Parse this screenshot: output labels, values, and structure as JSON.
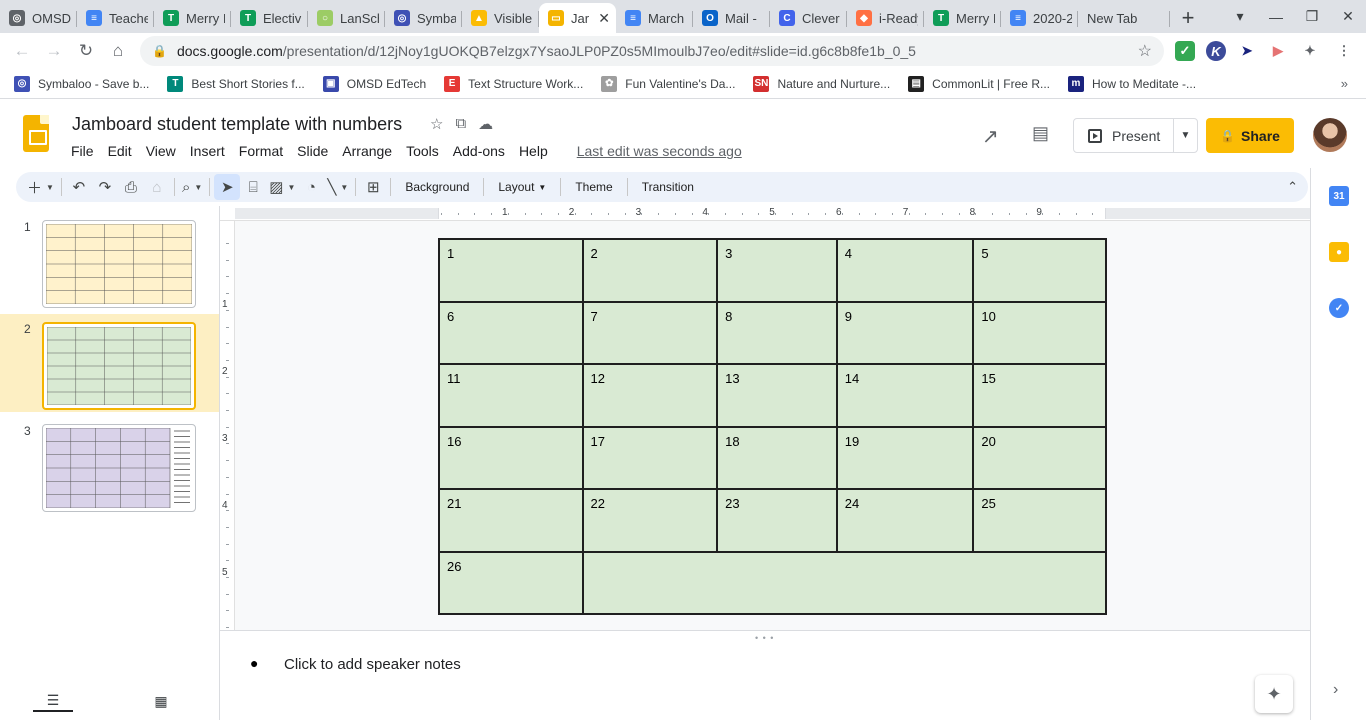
{
  "browser": {
    "tabs": [
      {
        "label": "OMSD",
        "icon": "omsd-icon",
        "color": "#5f6368",
        "glyph": "◎"
      },
      {
        "label": "Teache",
        "icon": "docs-icon",
        "color": "#4285f4",
        "glyph": "≡"
      },
      {
        "label": "Merry I",
        "icon": "sheets-plus-icon",
        "color": "#0f9d58",
        "glyph": "T"
      },
      {
        "label": "Electiv",
        "icon": "sheets-plus-icon",
        "color": "#0f9d58",
        "glyph": "T"
      },
      {
        "label": "LanSch",
        "icon": "lanschool-icon",
        "color": "#9ccc65",
        "glyph": "○"
      },
      {
        "label": "Symba",
        "icon": "symbaloo-icon",
        "color": "#3f51b5",
        "glyph": "◎"
      },
      {
        "label": "Visible",
        "icon": "drive-icon",
        "color": "#fbbc04",
        "glyph": "▲"
      },
      {
        "label": "Jar",
        "icon": "slides-icon",
        "color": "#f4b400",
        "glyph": "▭",
        "active": true
      },
      {
        "label": "March",
        "icon": "docs-icon",
        "color": "#4285f4",
        "glyph": "≡"
      },
      {
        "label": "Mail -",
        "icon": "outlook-icon",
        "color": "#0a64c9",
        "glyph": "O"
      },
      {
        "label": "Clever",
        "icon": "clever-icon",
        "color": "#4263eb",
        "glyph": "C"
      },
      {
        "label": "i-Ready",
        "icon": "iready-icon",
        "color": "#ff7043",
        "glyph": "◆"
      },
      {
        "label": "Merry I",
        "icon": "sheets-plus-icon",
        "color": "#0f9d58",
        "glyph": "T"
      },
      {
        "label": "2020-2",
        "icon": "docs-icon",
        "color": "#4285f4",
        "glyph": "≡"
      },
      {
        "label": "New Tab",
        "icon": "",
        "color": "",
        "glyph": ""
      }
    ],
    "url_host": "docs.google.com",
    "url_path": "/presentation/d/12jNoy1gUOKQB7elzgx7YsaoJLP0PZ0s5MImoulbJ7eo/edit#slide=id.g6c8b8fe1b_0_5",
    "bookmarks": [
      {
        "label": "Symbaloo - Save b...",
        "icon": "symbaloo-icon",
        "color": "#3f51b5",
        "glyph": "◎"
      },
      {
        "label": "Best Short Stories f...",
        "icon": "t-icon",
        "color": "#00897b",
        "glyph": "T"
      },
      {
        "label": "OMSD EdTech",
        "icon": "omsd-edtech-icon",
        "color": "#3949ab",
        "glyph": "▣"
      },
      {
        "label": "Text Structure Work...",
        "icon": "e-icon",
        "color": "#e53935",
        "glyph": "E"
      },
      {
        "label": "Fun Valentine's Da...",
        "icon": "valentine-icon",
        "color": "#9e9e9e",
        "glyph": "✿"
      },
      {
        "label": "Nature and Nurture...",
        "icon": "sn-icon",
        "color": "#d32f2f",
        "glyph": "SN"
      },
      {
        "label": "CommonLit | Free R...",
        "icon": "commonlit-icon",
        "color": "#212121",
        "glyph": "▤"
      },
      {
        "label": "How to Meditate -...",
        "icon": "m-icon",
        "color": "#1a237e",
        "glyph": "m"
      }
    ]
  },
  "app": {
    "title": "Jamboard student template with numbers",
    "menus": [
      "File",
      "Edit",
      "View",
      "Insert",
      "Format",
      "Slide",
      "Arrange",
      "Tools",
      "Add-ons",
      "Help"
    ],
    "last_edit": "Last edit was seconds ago",
    "present_label": "Present",
    "share_label": "Share"
  },
  "toolbar": {
    "background_label": "Background",
    "layout_label": "Layout",
    "theme_label": "Theme",
    "transition_label": "Transition"
  },
  "filmstrip": {
    "slides": [
      {
        "number": "1",
        "fill": "#fff2cc",
        "selected": false
      },
      {
        "number": "2",
        "fill": "#d9ead3",
        "selected": true
      },
      {
        "number": "3",
        "fill": "#d9d2e9",
        "selected": false
      }
    ]
  },
  "ruler": {
    "h_labels": [
      "1",
      "2",
      "3",
      "4",
      "5",
      "6",
      "7",
      "8",
      "9"
    ],
    "v_labels": [
      "1",
      "2",
      "3",
      "4",
      "5"
    ]
  },
  "slide": {
    "cell_fill": "#d9ead3",
    "rows": [
      [
        "1",
        "2",
        "3",
        "4",
        "5"
      ],
      [
        "6",
        "7",
        "8",
        "9",
        "10"
      ],
      [
        "11",
        "12",
        "13",
        "14",
        "15"
      ],
      [
        "16",
        "17",
        "18",
        "19",
        "20"
      ],
      [
        "21",
        "22",
        "23",
        "24",
        "25"
      ],
      [
        "26"
      ]
    ]
  },
  "notes": {
    "placeholder": "Click to add speaker notes"
  }
}
